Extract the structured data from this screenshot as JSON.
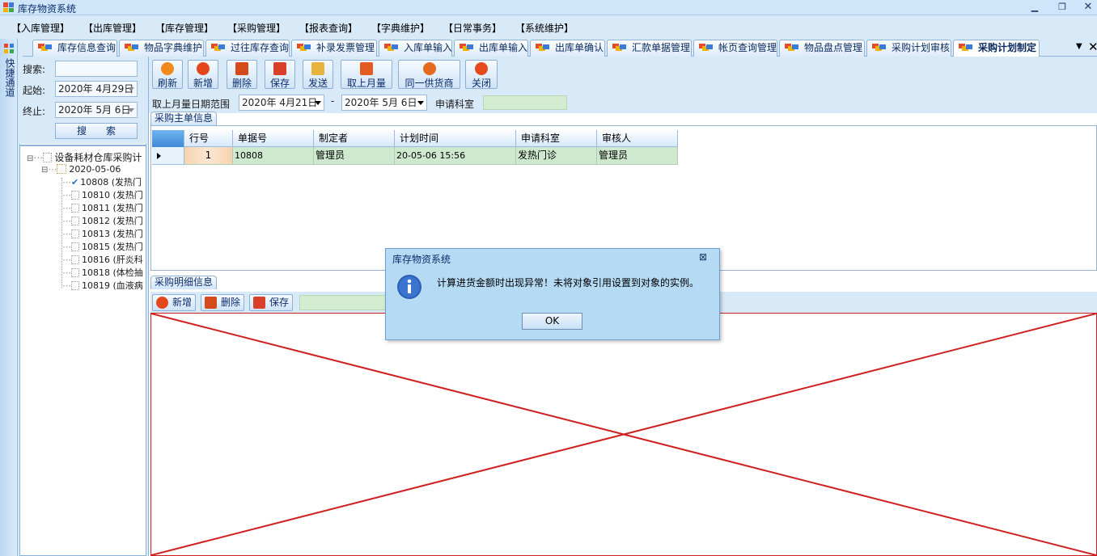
{
  "window": {
    "title": "库存物资系统"
  },
  "menu": [
    "【入库管理】",
    "【出库管理】",
    "【库存管理】",
    "【采购管理】",
    "【报表查询】",
    "【字典维护】",
    "【日常事务】",
    "【系统维护】"
  ],
  "tabs": [
    "库存信息查询",
    "物品字典维护",
    "过往库存查询",
    "补录发票管理",
    "入库单输入",
    "出库单输入",
    "出库单确认",
    "汇款单据管理",
    "帐页查询管理",
    "物品盘点管理",
    "采购计划审核",
    "采购计划制定"
  ],
  "active_tab": "采购计划制定",
  "quickbar": {
    "label": "快捷通道"
  },
  "left": {
    "search_label": "搜索:",
    "start_label": "起始:",
    "start_date": "2020年 4月29日",
    "end_label": "终止:",
    "end_date": "2020年 5月 6日",
    "search_button": "搜　　索",
    "tree_root": "设备耗材仓库采购计",
    "tree_date": "2020-05-06",
    "tree_items": [
      "10808 (发热门",
      "10810 (发热门",
      "10811 (发热门",
      "10812 (发热门",
      "10813 (发热门",
      "10815 (发热门",
      "10816 (肝炎科",
      "10818 (体检抽",
      "10819 (血液病"
    ]
  },
  "toolbar": {
    "refresh": "刷新",
    "add": "新增",
    "delete": "删除",
    "save": "保存",
    "send": "发送",
    "fetch_last_month": "取上月量",
    "same_supplier": "同一供货商",
    "close": "关闭"
  },
  "daterange": {
    "label": "取上月量日期范围",
    "from": "2020年 4月21日",
    "sep": "-",
    "to": "2020年 5月 6日",
    "dept_label": "申请科室"
  },
  "master": {
    "caption": "采购主单信息",
    "columns": [
      "行号",
      "单据号",
      "制定者",
      "计划时间",
      "申请科室",
      "审核人"
    ],
    "rows": [
      [
        "1",
        "10808",
        "管理员",
        "20-05-06  15:56",
        "发热门诊",
        "管理员"
      ]
    ]
  },
  "detail": {
    "caption": "采购明细信息",
    "add": "新增",
    "delete": "删除",
    "save": "保存"
  },
  "dialog": {
    "title": "库存物资系统",
    "message": "计算进货金额时出现异常！未将对象引用设置到对象的实例。",
    "ok": "OK"
  },
  "colors": {
    "error_cross": "#cf2020",
    "grid_row": "#cfe9cf",
    "accent": "#d8e9f8"
  }
}
